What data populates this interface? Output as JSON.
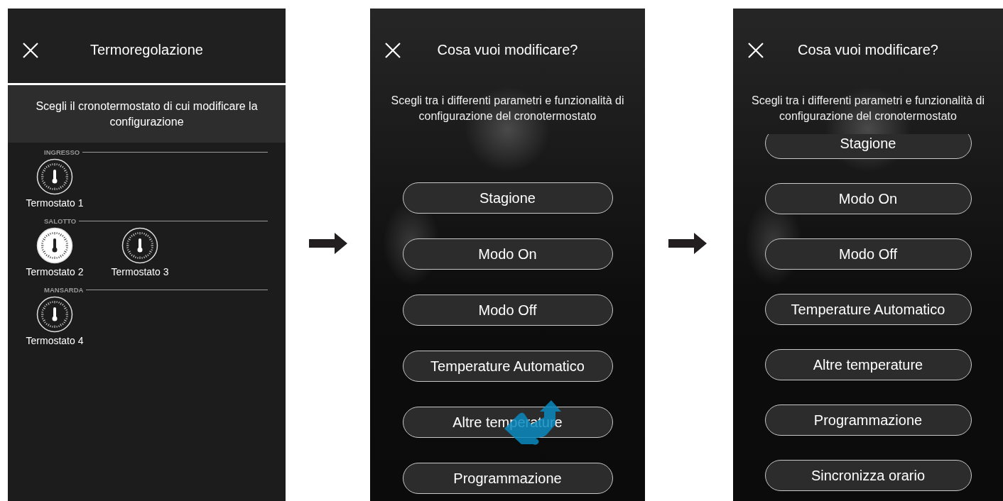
{
  "screens": [
    {
      "kind": "picker",
      "title": "Termoregolazione",
      "subtitle": "Scegli il cronotermostato di cui modificare la configurazione",
      "groups": [
        {
          "label": "INGRESSO",
          "items": [
            {
              "name": "Termostato 1",
              "selected": false
            }
          ]
        },
        {
          "label": "SALOTTO",
          "items": [
            {
              "name": "Termostato 2",
              "selected": true
            },
            {
              "name": "Termostato 3",
              "selected": false
            }
          ]
        },
        {
          "label": "MANSARDA",
          "items": [
            {
              "name": "Termostato 4",
              "selected": false
            }
          ]
        }
      ]
    },
    {
      "kind": "menu",
      "title": "Cosa vuoi modificare?",
      "subtitle": "Scegli tra i differenti parametri e funzionalità di configurazione del cronotermostato",
      "scrolled": false,
      "touch_hint": true,
      "options": [
        "Stagione",
        "Modo On",
        "Modo Off",
        "Temperature Automatico",
        "Altre temperature",
        "Programmazione"
      ]
    },
    {
      "kind": "menu",
      "title": "Cosa vuoi modificare?",
      "subtitle": "Scegli tra i differenti parametri e funzionalità di configurazione del cronotermostato",
      "scrolled": true,
      "touch_hint": false,
      "options": [
        "Stagione",
        "Modo On",
        "Modo Off",
        "Temperature Automatico",
        "Altre temperature",
        "Programmazione",
        "Sincronizza orario"
      ]
    }
  ]
}
